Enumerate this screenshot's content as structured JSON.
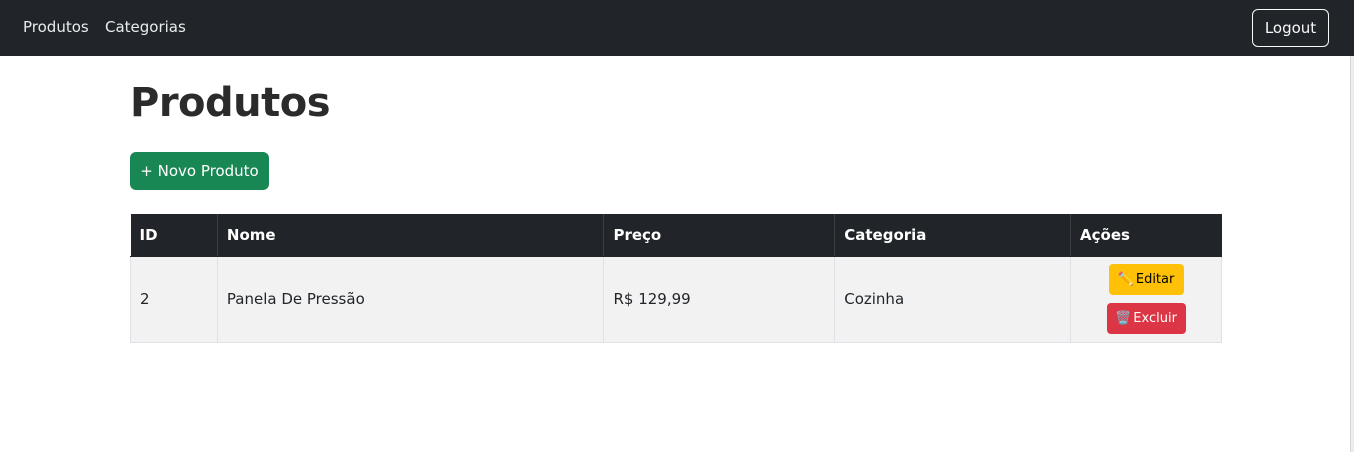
{
  "nav": {
    "links": [
      "Produtos",
      "Categorias"
    ],
    "logout_label": "Logout"
  },
  "page": {
    "title": "Produtos",
    "new_button_label": "+ Novo Produto"
  },
  "table": {
    "headers": [
      "ID",
      "Nome",
      "Preço",
      "Categoria",
      "Ações"
    ],
    "rows": [
      {
        "id": "2",
        "nome": "Panela De Pressão",
        "preco": "R$ 129,99",
        "categoria": "Cozinha",
        "edit_label": "Editar",
        "delete_label": "Excluir"
      }
    ]
  },
  "icons": {
    "edit": "pencil-icon",
    "delete": "trash-icon"
  },
  "colors": {
    "navbar": "#212529",
    "success": "#198754",
    "warning": "#ffc107",
    "danger": "#dc3545"
  }
}
